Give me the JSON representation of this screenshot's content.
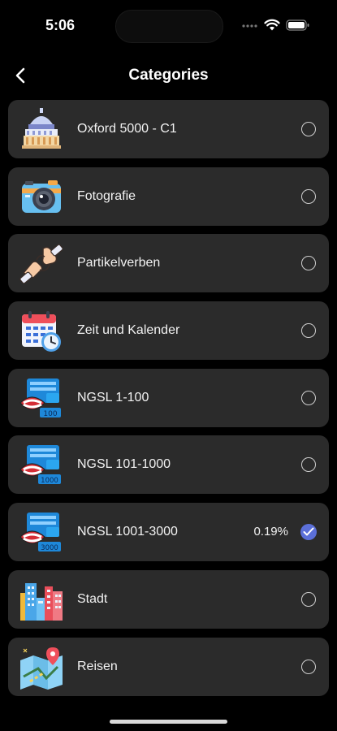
{
  "status": {
    "time": "5:06"
  },
  "nav": {
    "title": "Categories"
  },
  "categories": [
    {
      "label": "Oxford 5000 - C1",
      "icon": "capitol-building-icon",
      "selected": false,
      "progress": ""
    },
    {
      "label": "Fotografie",
      "icon": "camera-icon",
      "selected": false,
      "progress": ""
    },
    {
      "label": "Partikelverben",
      "icon": "sign-language-hands-icon",
      "selected": false,
      "progress": ""
    },
    {
      "label": "Zeit und Kalender",
      "icon": "calendar-clock-icon",
      "selected": false,
      "progress": ""
    },
    {
      "label": "NGSL 1-100",
      "icon": "ngsl-mouth-speech-icon",
      "badge": "100",
      "selected": false,
      "progress": ""
    },
    {
      "label": "NGSL 101-1000",
      "icon": "ngsl-mouth-speech-icon",
      "badge": "1000",
      "selected": false,
      "progress": ""
    },
    {
      "label": "NGSL 1001-3000",
      "icon": "ngsl-mouth-speech-icon",
      "badge": "3000",
      "selected": true,
      "progress": "0.19%"
    },
    {
      "label": "Stadt",
      "icon": "city-buildings-icon",
      "selected": false,
      "progress": ""
    },
    {
      "label": "Reisen",
      "icon": "travel-map-icon",
      "selected": false,
      "progress": ""
    }
  ],
  "colors": {
    "row_bg": "#2b2b2b",
    "accent": "#5b6fd8",
    "background": "#000000"
  }
}
